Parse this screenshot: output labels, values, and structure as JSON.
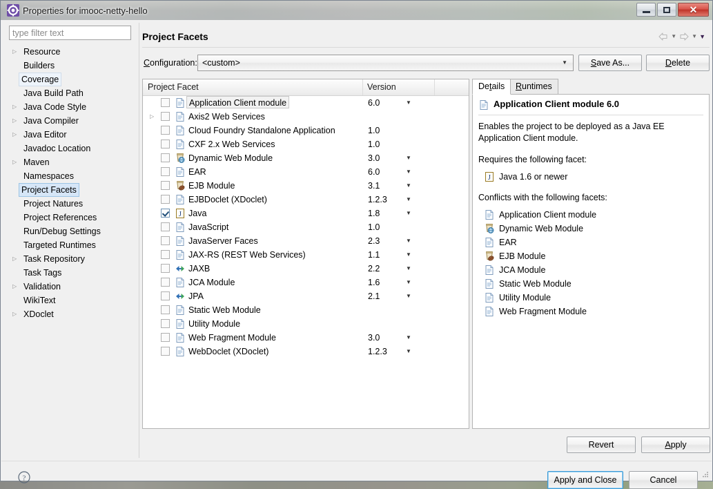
{
  "window": {
    "title": "Properties for imooc-netty-hello",
    "icon": "eclipse-properties-icon",
    "minimize_label": "Minimize",
    "maximize_label": "Maximize",
    "close_label": "✕"
  },
  "filter": {
    "placeholder": "type filter text",
    "value": ""
  },
  "sidebar": {
    "items": [
      {
        "label": "Resource",
        "expandable": true,
        "selected": false
      },
      {
        "label": "Builders",
        "expandable": false,
        "selected": false
      },
      {
        "label": "Coverage",
        "expandable": false,
        "selected": false,
        "hover": true
      },
      {
        "label": "Java Build Path",
        "expandable": false,
        "selected": false
      },
      {
        "label": "Java Code Style",
        "expandable": true,
        "selected": false
      },
      {
        "label": "Java Compiler",
        "expandable": true,
        "selected": false
      },
      {
        "label": "Java Editor",
        "expandable": true,
        "selected": false
      },
      {
        "label": "Javadoc Location",
        "expandable": false,
        "selected": false
      },
      {
        "label": "Maven",
        "expandable": true,
        "selected": false
      },
      {
        "label": "Namespaces",
        "expandable": false,
        "selected": false
      },
      {
        "label": "Project Facets",
        "expandable": false,
        "selected": true
      },
      {
        "label": "Project Natures",
        "expandable": false,
        "selected": false
      },
      {
        "label": "Project References",
        "expandable": false,
        "selected": false
      },
      {
        "label": "Run/Debug Settings",
        "expandable": false,
        "selected": false
      },
      {
        "label": "Targeted Runtimes",
        "expandable": false,
        "selected": false
      },
      {
        "label": "Task Repository",
        "expandable": true,
        "selected": false
      },
      {
        "label": "Task Tags",
        "expandable": false,
        "selected": false
      },
      {
        "label": "Validation",
        "expandable": true,
        "selected": false
      },
      {
        "label": "WikiText",
        "expandable": false,
        "selected": false
      },
      {
        "label": "XDoclet",
        "expandable": true,
        "selected": false
      }
    ]
  },
  "page": {
    "title": "Project Facets",
    "nav_back_icon": "back-arrow-icon",
    "nav_forward_icon": "forward-arrow-icon",
    "nav_menu_icon": "chevron-down-icon"
  },
  "config": {
    "label": "Configuration:",
    "value": "<custom>",
    "save_as_label": "Save As...",
    "delete_label": "Delete"
  },
  "facet_table": {
    "columns": [
      "Project Facet",
      "Version"
    ],
    "rows": [
      {
        "name": "Application Client module",
        "version": "6.0",
        "checked": false,
        "expandable": false,
        "has_version_menu": true,
        "icon": "doc-icon",
        "selected": true
      },
      {
        "name": "Axis2 Web Services",
        "version": "",
        "checked": false,
        "expandable": true,
        "has_version_menu": false,
        "icon": "doc-icon",
        "selected": false
      },
      {
        "name": "Cloud Foundry Standalone Application",
        "version": "1.0",
        "checked": false,
        "expandable": false,
        "has_version_menu": false,
        "icon": "doc-icon",
        "selected": false
      },
      {
        "name": "CXF 2.x Web Services",
        "version": "1.0",
        "checked": false,
        "expandable": false,
        "has_version_menu": false,
        "icon": "doc-icon",
        "selected": false
      },
      {
        "name": "Dynamic Web Module",
        "version": "3.0",
        "checked": false,
        "expandable": false,
        "has_version_menu": true,
        "icon": "web-jar-icon",
        "selected": false
      },
      {
        "name": "EAR",
        "version": "6.0",
        "checked": false,
        "expandable": false,
        "has_version_menu": true,
        "icon": "doc-icon",
        "selected": false
      },
      {
        "name": "EJB Module",
        "version": "3.1",
        "checked": false,
        "expandable": false,
        "has_version_menu": true,
        "icon": "ejb-jar-icon",
        "selected": false
      },
      {
        "name": "EJBDoclet (XDoclet)",
        "version": "1.2.3",
        "checked": false,
        "expandable": false,
        "has_version_menu": true,
        "icon": "doc-icon",
        "selected": false
      },
      {
        "name": "Java",
        "version": "1.8",
        "checked": true,
        "expandable": false,
        "has_version_menu": true,
        "icon": "java-icon",
        "selected": false
      },
      {
        "name": "JavaScript",
        "version": "1.0",
        "checked": false,
        "expandable": false,
        "has_version_menu": false,
        "icon": "doc-icon",
        "selected": false
      },
      {
        "name": "JavaServer Faces",
        "version": "2.3",
        "checked": false,
        "expandable": false,
        "has_version_menu": true,
        "icon": "doc-icon",
        "selected": false
      },
      {
        "name": "JAX-RS (REST Web Services)",
        "version": "1.1",
        "checked": false,
        "expandable": false,
        "has_version_menu": true,
        "icon": "doc-icon",
        "selected": false
      },
      {
        "name": "JAXB",
        "version": "2.2",
        "checked": false,
        "expandable": false,
        "has_version_menu": true,
        "icon": "arrows-icon",
        "selected": false
      },
      {
        "name": "JCA Module",
        "version": "1.6",
        "checked": false,
        "expandable": false,
        "has_version_menu": true,
        "icon": "doc-icon",
        "selected": false
      },
      {
        "name": "JPA",
        "version": "2.1",
        "checked": false,
        "expandable": false,
        "has_version_menu": true,
        "icon": "arrows-icon",
        "selected": false
      },
      {
        "name": "Static Web Module",
        "version": "",
        "checked": false,
        "expandable": false,
        "has_version_menu": false,
        "icon": "doc-icon",
        "selected": false
      },
      {
        "name": "Utility Module",
        "version": "",
        "checked": false,
        "expandable": false,
        "has_version_menu": false,
        "icon": "doc-icon",
        "selected": false
      },
      {
        "name": "Web Fragment Module",
        "version": "3.0",
        "checked": false,
        "expandable": false,
        "has_version_menu": true,
        "icon": "doc-icon",
        "selected": false
      },
      {
        "name": "WebDoclet (XDoclet)",
        "version": "1.2.3",
        "checked": false,
        "expandable": false,
        "has_version_menu": true,
        "icon": "doc-icon",
        "selected": false
      }
    ]
  },
  "details": {
    "tabs": [
      {
        "label": "Details",
        "mnemonic": "t",
        "active": true
      },
      {
        "label": "Runtimes",
        "mnemonic": "R",
        "active": false
      }
    ],
    "header_title": "Application Client module 6.0",
    "header_icon": "doc-icon",
    "description": "Enables the project to be deployed as a Java EE Application Client module.",
    "requires_heading": "Requires the following facet:",
    "requires": [
      {
        "label": "Java 1.6 or newer",
        "icon": "java-icon"
      }
    ],
    "conflicts_heading": "Conflicts with the following facets:",
    "conflicts": [
      {
        "label": "Application Client module",
        "icon": "doc-icon"
      },
      {
        "label": "Dynamic Web Module",
        "icon": "web-jar-icon"
      },
      {
        "label": "EAR",
        "icon": "doc-icon"
      },
      {
        "label": "EJB Module",
        "icon": "ejb-jar-icon"
      },
      {
        "label": "JCA Module",
        "icon": "doc-icon"
      },
      {
        "label": "Static Web Module",
        "icon": "doc-icon"
      },
      {
        "label": "Utility Module",
        "icon": "doc-icon"
      },
      {
        "label": "Web Fragment Module",
        "icon": "doc-icon"
      }
    ]
  },
  "actions": {
    "revert_label": "Revert",
    "apply_label": "Apply",
    "apply_and_close_label": "Apply and Close",
    "cancel_label": "Cancel",
    "help_icon": "help-question-icon"
  },
  "colors": {
    "accent": "#3c9ad6",
    "selection": "#d6e6f7",
    "dialog_bg": "#f0f0f0",
    "close_button": "#c03429"
  }
}
